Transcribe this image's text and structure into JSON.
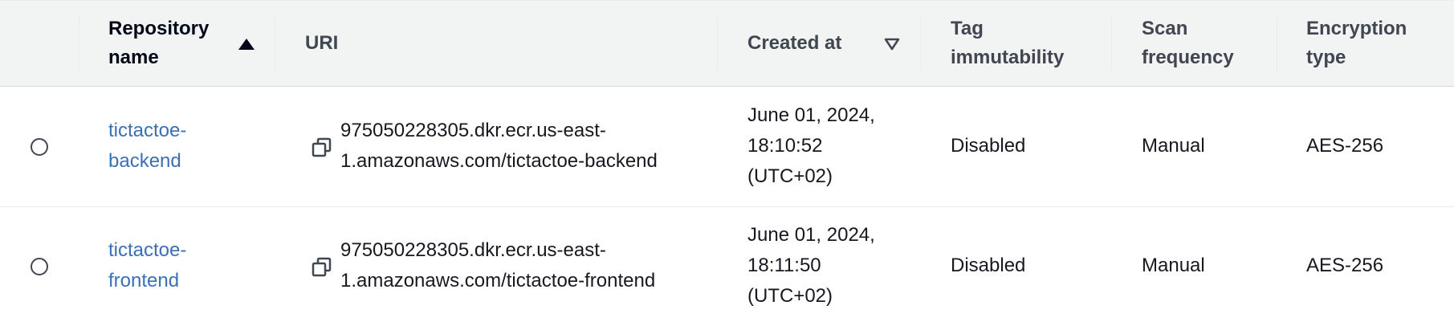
{
  "columns": {
    "repository_name": [
      "Repository",
      "name"
    ],
    "uri": "URI",
    "created_at": "Created at",
    "tag_immutability": [
      "Tag",
      "immutability"
    ],
    "scan_frequency": [
      "Scan",
      "frequency"
    ],
    "encryption_type": [
      "Encryption",
      "type"
    ]
  },
  "sort": {
    "repository_name": "ascending",
    "created_at": "descending"
  },
  "rows": [
    {
      "name": [
        "tictactoe-",
        "backend"
      ],
      "uri": [
        "975050228305.dkr.ecr.us-east-",
        "1.amazonaws.com/tictactoe-backend"
      ],
      "created_at": [
        "June 01, 2024,",
        "18:10:52",
        "(UTC+02)"
      ],
      "tag_immutability": "Disabled",
      "scan_frequency": "Manual",
      "encryption_type": "AES-256"
    },
    {
      "name": [
        "tictactoe-",
        "frontend"
      ],
      "uri": [
        "975050228305.dkr.ecr.us-east-",
        "1.amazonaws.com/tictactoe-frontend"
      ],
      "created_at": [
        "June 01, 2024,",
        "18:11:50",
        "(UTC+02)"
      ],
      "tag_immutability": "Disabled",
      "scan_frequency": "Manual",
      "encryption_type": "AES-256"
    }
  ],
  "colors": {
    "header_bg": "#f2f3f3",
    "link": "#3b6fb6",
    "text": "#16191f",
    "border": "#e9ebed"
  },
  "icons": [
    "sort-ascending-icon",
    "sort-descending-icon",
    "copy-icon",
    "radio-button"
  ]
}
